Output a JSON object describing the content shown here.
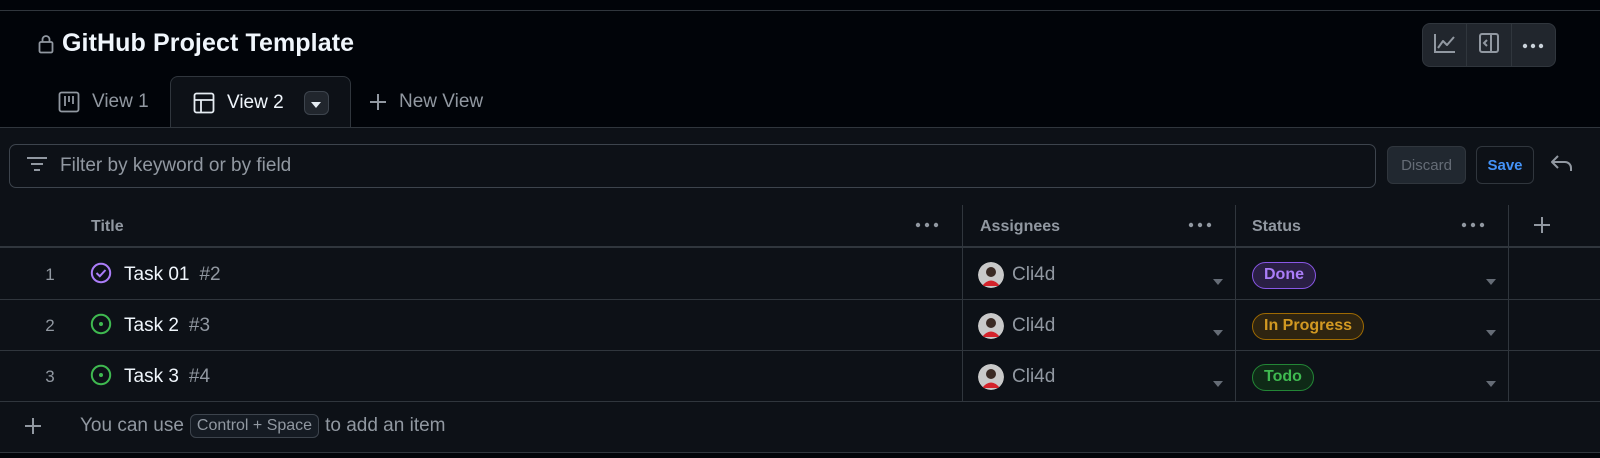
{
  "project": {
    "title": "GitHub Project Template"
  },
  "top_actions": [
    "insights-icon",
    "side-panel-icon",
    "kebab-icon"
  ],
  "tabs": [
    {
      "label": "View 1",
      "icon": "board-icon",
      "active": false
    },
    {
      "label": "View 2",
      "icon": "table-icon",
      "active": true
    },
    {
      "label": "New View",
      "icon": "plus-icon",
      "active": false
    }
  ],
  "filter": {
    "placeholder": "Filter by keyword or by field",
    "discard_label": "Discard",
    "save_label": "Save"
  },
  "table": {
    "columns": [
      {
        "label": "Title"
      },
      {
        "label": "Assignees"
      },
      {
        "label": "Status"
      }
    ],
    "rows": [
      {
        "num": "1",
        "title": "Task 01",
        "issue": "#2",
        "state": "closed",
        "assignee": "Cli4d",
        "status": "Done"
      },
      {
        "num": "2",
        "title": "Task 2",
        "issue": "#3",
        "state": "open",
        "assignee": "Cli4d",
        "status": "In Progress"
      },
      {
        "num": "3",
        "title": "Task 3",
        "issue": "#4",
        "state": "open",
        "assignee": "Cli4d",
        "status": "Todo"
      }
    ],
    "add_hint": {
      "before": "You can use",
      "kbd": "Control + Space",
      "after": "to add an item"
    }
  },
  "colors": {
    "background": "#010409",
    "surface": "#0d1117",
    "border": "#30363d",
    "done": "#ab7df8",
    "in_progress": "#d29922",
    "todo": "#3fb950",
    "link": "#4493f8"
  }
}
